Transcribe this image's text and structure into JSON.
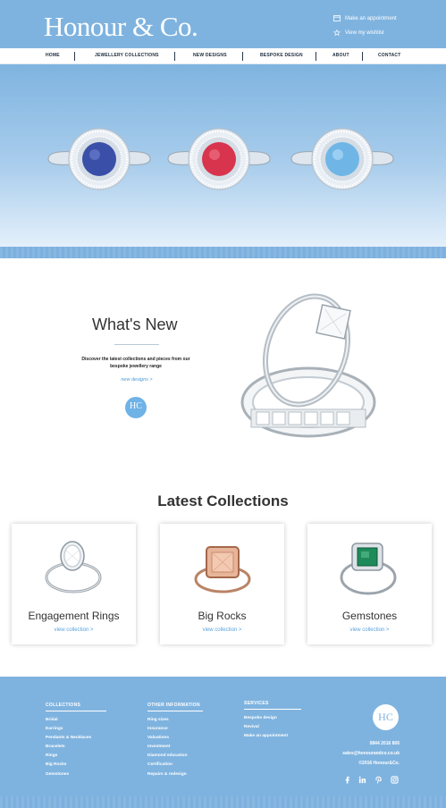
{
  "header": {
    "logo": "Honour & Co.",
    "appointment": "Make an appointment",
    "wishlist": "View my wishlist"
  },
  "nav": [
    "HOME",
    "JEWELLERY COLLECTIONS",
    "NEW DESIGNS",
    "BESPOKE DESIGN",
    "ABOUT",
    "CONTACT"
  ],
  "hero": {
    "rings": [
      {
        "name": "sapphire-ring",
        "stone_color": "#3a4fa8"
      },
      {
        "name": "ruby-ring",
        "stone_color": "#d8344d"
      },
      {
        "name": "aquamarine-ring",
        "stone_color": "#6fb6e6"
      }
    ]
  },
  "whats_new": {
    "title": "What's New",
    "description": "Discover the latest collections and pieces from our bespoke jewellery range",
    "link": "new designs >",
    "badge": "HC"
  },
  "latest": {
    "title": "Latest Collections",
    "cards": [
      {
        "name": "Engagement Rings",
        "link": "view collection >"
      },
      {
        "name": "Big Rocks",
        "link": "view collection >"
      },
      {
        "name": "Gemstones",
        "link": "view collection >"
      }
    ]
  },
  "footer": {
    "collections": {
      "heading": "COLLECTIONS",
      "items": [
        "Bridal",
        "Earrings",
        "Pendants & Necklaces",
        "Bracelets",
        "Rings",
        "Big Rocks",
        "Gemstones"
      ]
    },
    "other": {
      "heading": "OTHER INFORMATION",
      "items": [
        "Ring sizes",
        "Insurance",
        "Valuations",
        "Investment",
        "Diamond education",
        "Certification",
        "Repairs & redesign"
      ]
    },
    "services": {
      "heading": "SERVICES",
      "items": [
        "Bespoke design",
        "Revival",
        "Make an appointment"
      ]
    },
    "badge": "HC",
    "phone": "0844 2016 806",
    "email": "sales@honourandco.co.uk",
    "copyright": "©2016 Honour&Co.",
    "social": [
      "facebook-icon",
      "linkedin-icon",
      "pinterest-icon",
      "instagram-icon"
    ]
  },
  "colors": {
    "brand_blue": "#7fb3df",
    "link_blue": "#5aa2dc"
  }
}
